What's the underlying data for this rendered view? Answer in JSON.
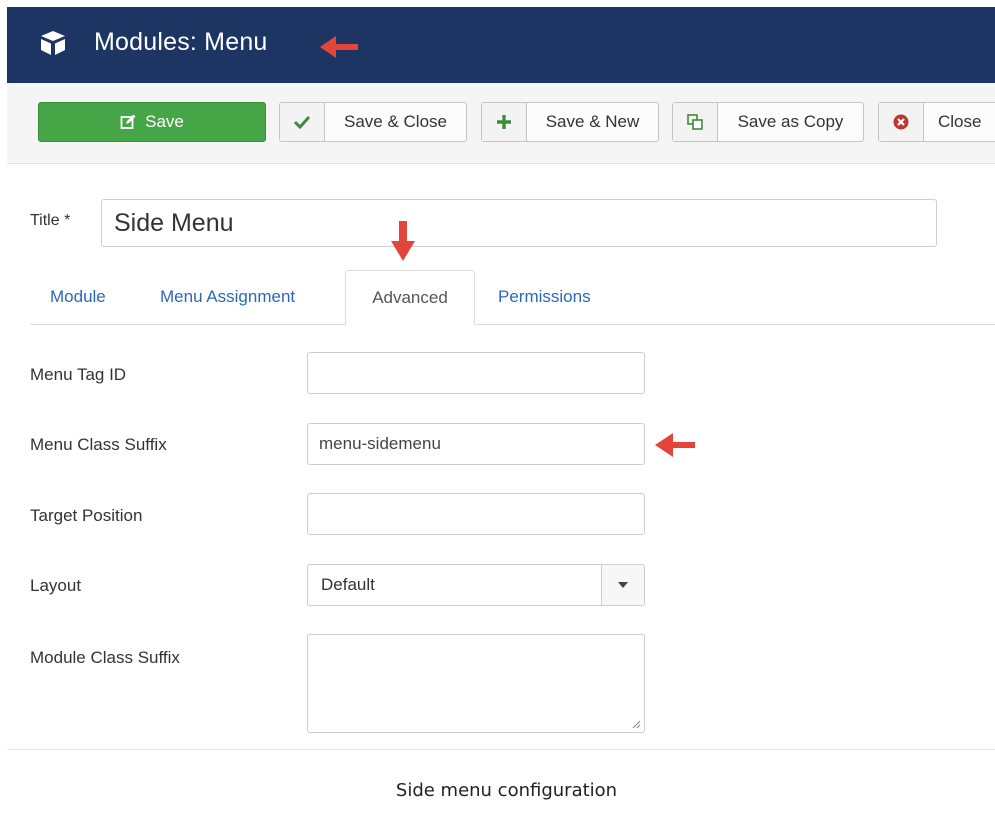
{
  "header": {
    "title": "Modules: Menu",
    "background": "#1c3563",
    "icon": "cube-icon"
  },
  "toolbar": {
    "save_label": "Save",
    "save_close_label": "Save & Close",
    "save_new_label": "Save & New",
    "save_copy_label": "Save as Copy",
    "close_label": "Close",
    "save_color": "#46a546"
  },
  "form": {
    "title_label": "Title *",
    "title_value": "Side Menu"
  },
  "tabs": [
    {
      "label": "Module",
      "active": false
    },
    {
      "label": "Menu Assignment",
      "active": false
    },
    {
      "label": "Advanced",
      "active": true
    },
    {
      "label": "Permissions",
      "active": false
    }
  ],
  "fields": {
    "menu_tag_id": {
      "label": "Menu Tag ID",
      "value": ""
    },
    "menu_class_suffix": {
      "label": "Menu Class Suffix",
      "value": "menu-sidemenu"
    },
    "target_position": {
      "label": "Target Position",
      "value": ""
    },
    "layout": {
      "label": "Layout",
      "value": "Default"
    },
    "module_class_suffix": {
      "label": "Module Class Suffix",
      "value": ""
    }
  },
  "annotation_color": "#e4453b",
  "caption": "Side menu configuration"
}
